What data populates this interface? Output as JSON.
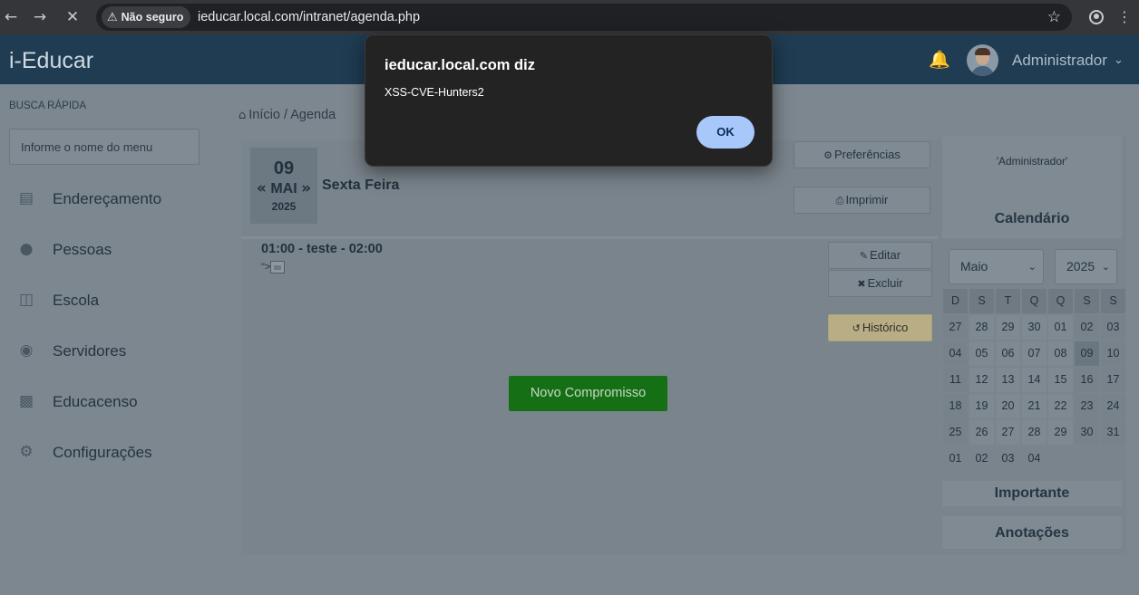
{
  "browser": {
    "security_label": "Não seguro",
    "url": "ieducar.local.com/intranet/agenda.php",
    "icons": [
      "back-icon",
      "forward-icon",
      "stop-icon",
      "warning-icon",
      "star-icon",
      "profile-icon",
      "more-icon"
    ]
  },
  "header": {
    "logo": "i-Educar",
    "user": "Administrador"
  },
  "sidebar": {
    "quick_search_label": "BUSCA RÁPIDA",
    "quick_search_placeholder": "Informe o nome do menu",
    "items": [
      {
        "label": "Endereçamento",
        "icon": "map-icon"
      },
      {
        "label": "Pessoas",
        "icon": "user-icon"
      },
      {
        "label": "Escola",
        "icon": "book-icon"
      },
      {
        "label": "Servidores",
        "icon": "users-icon"
      },
      {
        "label": "Educacenso",
        "icon": "bar-chart-icon"
      },
      {
        "label": "Configurações",
        "icon": "gear-icon"
      }
    ]
  },
  "breadcrumb": {
    "home": "Início",
    "separator": "/",
    "current": "Agenda"
  },
  "date": {
    "day": "09",
    "month": "MAI",
    "year": "2025",
    "prev_arrow": "«",
    "next_arrow": "»",
    "weekday": "Sexta Feira"
  },
  "actions": {
    "preferences": "Preferências",
    "print": "Imprimir",
    "edit": "Editar",
    "delete": "Excluir",
    "history": "Histórico",
    "new_appointment": "Novo Compromisso"
  },
  "event": {
    "title": "01:00 - teste - 02:00",
    "description_prefix": "\">"
  },
  "right_panel": {
    "user": "'Administrador'",
    "calendar_title": "Calendário",
    "month_select": "Maio",
    "year_select": "2025",
    "weekday_headers": [
      "D",
      "S",
      "T",
      "Q",
      "Q",
      "S",
      "S"
    ],
    "weeks": [
      [
        "27",
        "28",
        "29",
        "30",
        "01",
        "02",
        "03"
      ],
      [
        "04",
        "05",
        "06",
        "07",
        "08",
        "09",
        "10"
      ],
      [
        "11",
        "12",
        "13",
        "14",
        "15",
        "16",
        "17"
      ],
      [
        "18",
        "19",
        "20",
        "21",
        "22",
        "23",
        "24"
      ],
      [
        "25",
        "26",
        "27",
        "28",
        "29",
        "30",
        "31"
      ],
      [
        "01",
        "02",
        "03",
        "04"
      ]
    ],
    "selected_day": "09",
    "important_title": "Importante",
    "notes_title": "Anotações"
  },
  "dialog": {
    "title": "ieducar.local.com diz",
    "message": "XSS-CVE-Hunters2",
    "ok": "OK"
  }
}
